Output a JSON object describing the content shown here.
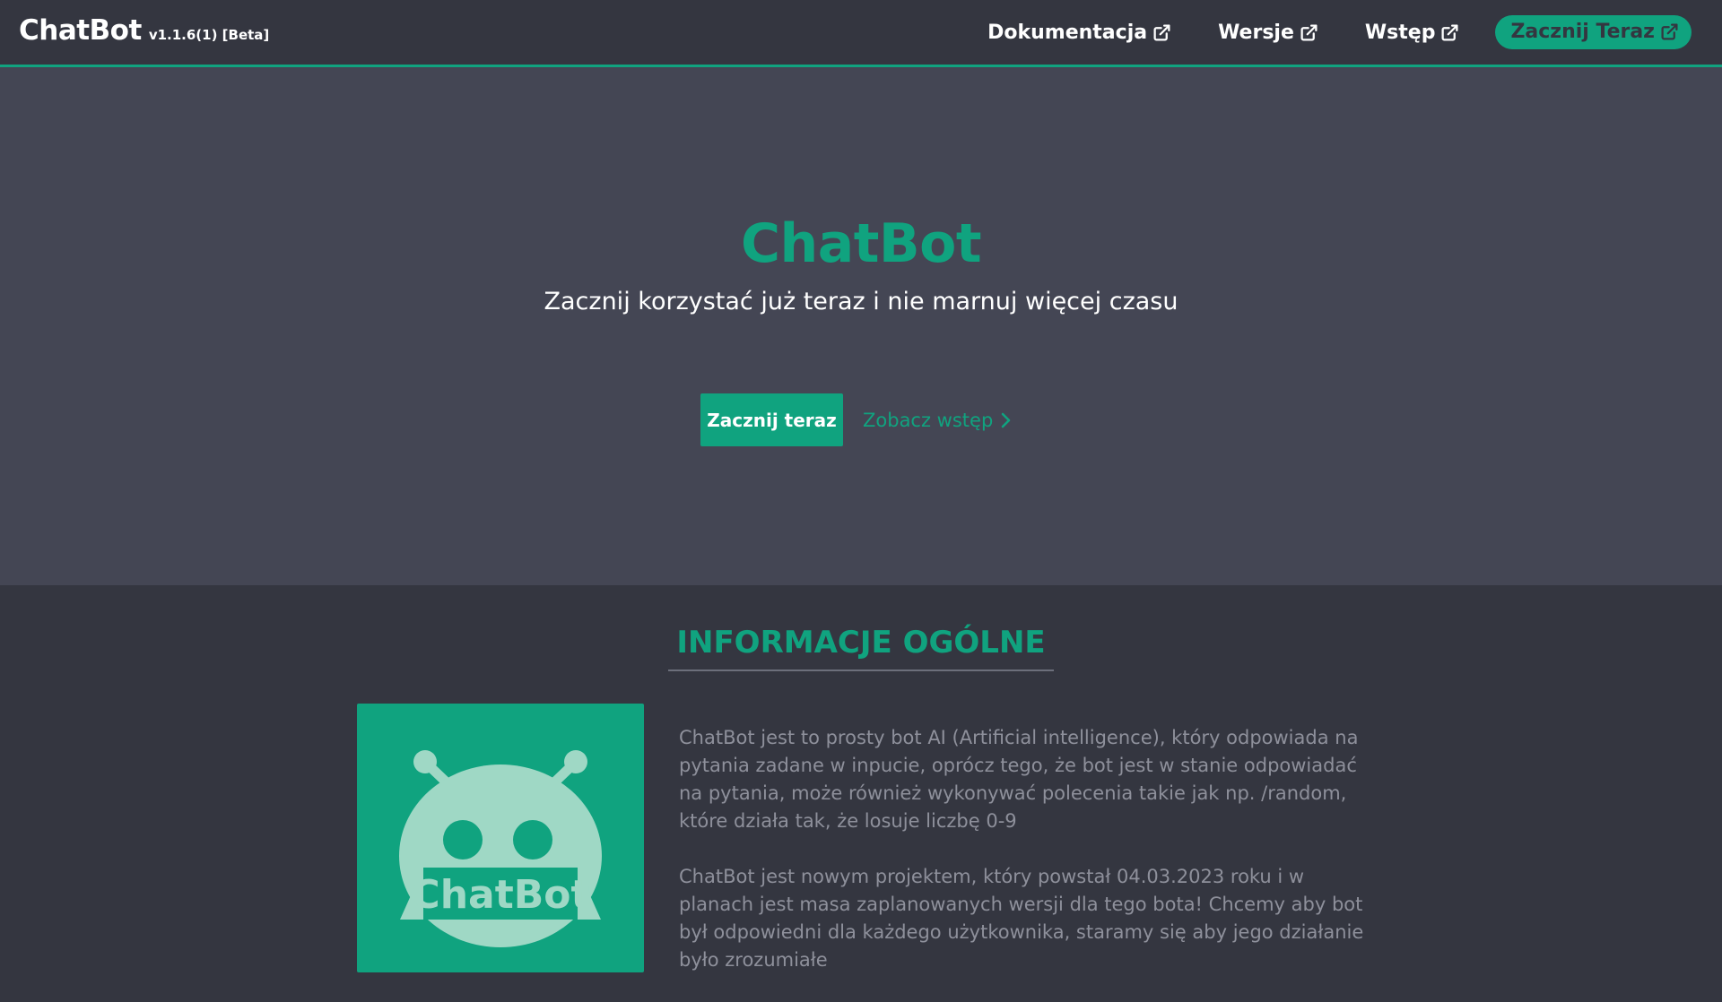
{
  "navbar": {
    "brand_name": "ChatBot",
    "brand_version": "v1.1.6(1) [Beta]",
    "links": [
      {
        "label": "Dokumentacja",
        "icon": "external-link-icon"
      },
      {
        "label": "Wersje",
        "icon": "external-link-icon"
      },
      {
        "label": "Wstęp",
        "icon": "external-link-icon"
      },
      {
        "label": "Zacznij Teraz",
        "icon": "external-link-icon"
      }
    ]
  },
  "hero": {
    "title": "ChatBot",
    "subtitle": "Zacznij korzystać już teraz i nie marnuj więcej czasu",
    "primary_button": "Zacznij teraz",
    "secondary_link": "Zobacz wstęp",
    "secondary_icon": "chevron-right-icon"
  },
  "info": {
    "heading": "INFORMACJE OGÓLNE",
    "logo_text": "ChatBot",
    "paragraphs": [
      "ChatBot jest to prosty bot AI (Artificial intelligence), który odpowiada na pytania zadane w inpucie, oprócz tego, że bot jest w stanie odpowiadać na pytania, może również wykonywać polecenia takie jak np. /random, które działa tak, że losuje liczbę 0-9",
      "ChatBot jest nowym projektem, który powstał 04.03.2023 roku i w planach jest masa zaplanowanych wersji dla tego bota! Chcemy aby bot był odpowiedni dla każdego użytkownika, staramy się aby jego działanie było zrozumiałe"
    ]
  },
  "colors": {
    "accent": "#10a37f",
    "nav_background": "#343640",
    "hero_background": "#444654",
    "section_background": "#343640",
    "muted_text": "#8e909b",
    "logo_face": "#9fd8c5"
  }
}
